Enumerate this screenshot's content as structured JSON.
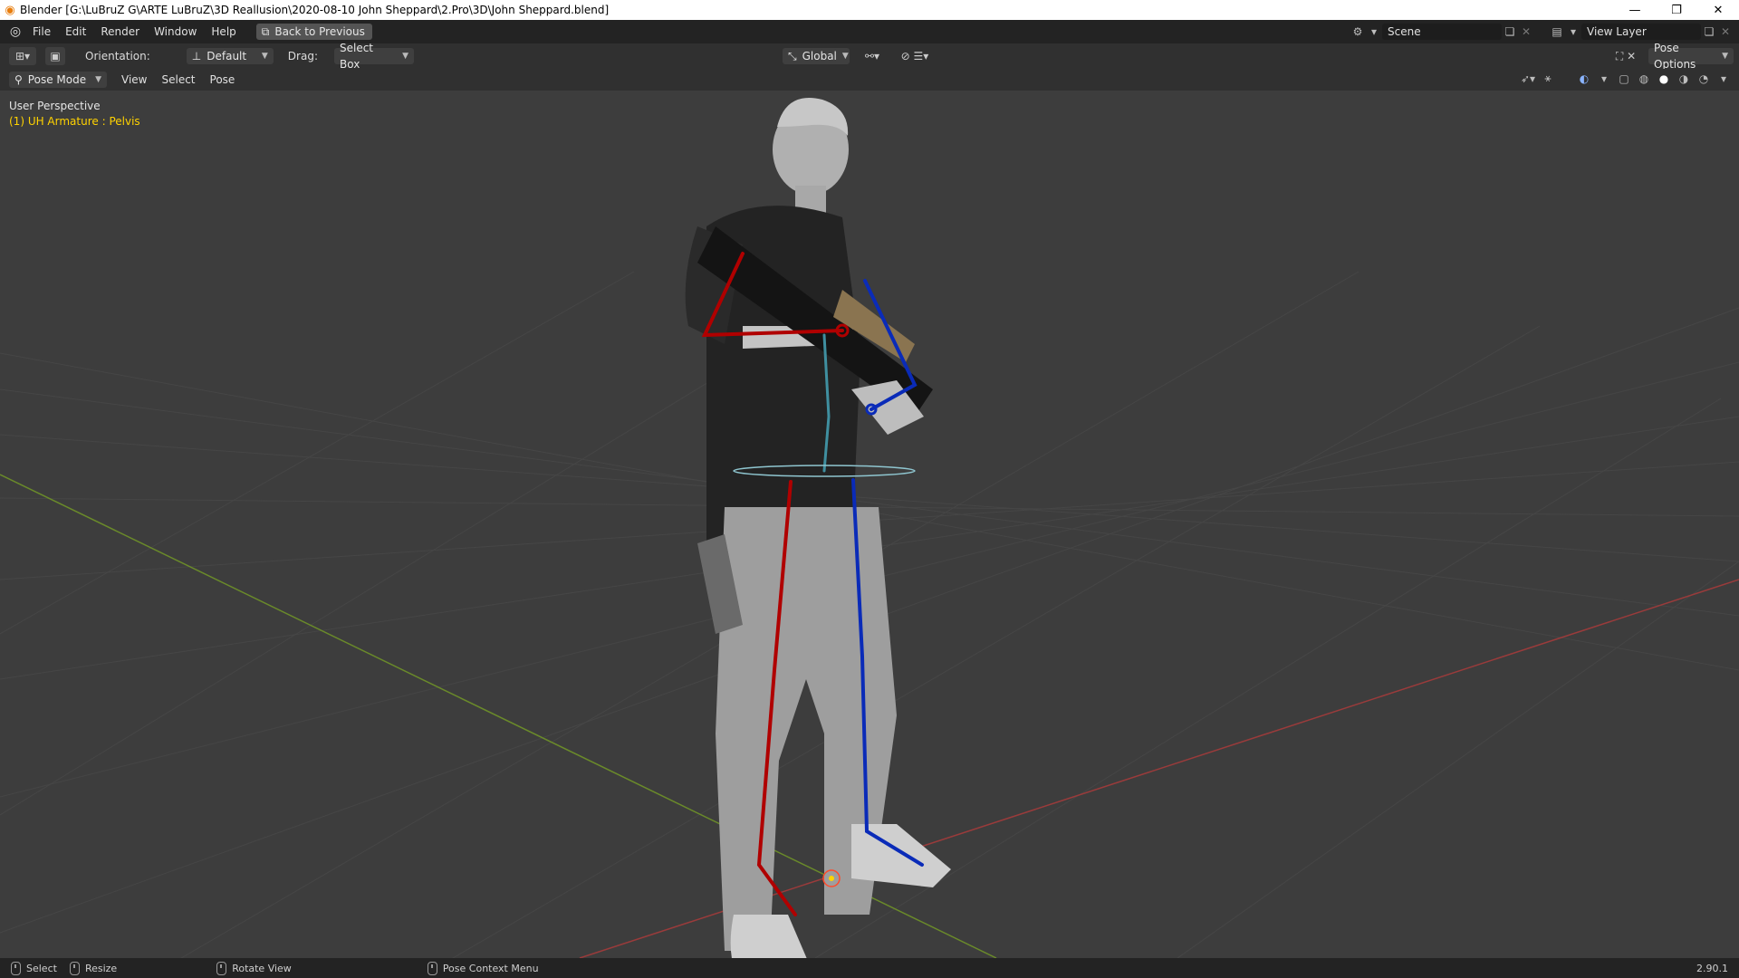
{
  "window": {
    "title": "Blender [G:\\LuBruZ G\\ARTE LuBruZ\\3D Reallusion\\2020-08-10 John Sheppard\\2.Pro\\3D\\John Sheppard.blend]",
    "minimize_glyph": "—",
    "restore_glyph": "❐",
    "close_glyph": "✕"
  },
  "topbar": {
    "menus": [
      "File",
      "Edit",
      "Render",
      "Window",
      "Help"
    ],
    "back_button": "Back to Previous",
    "scene_name": "Scene",
    "view_layer_name": "View Layer"
  },
  "toolheader": {
    "orientation_label": "Orientation:",
    "orientation_value": "Default",
    "drag_label": "Drag:",
    "drag_value": "Select Box",
    "transform_orientation": "Global",
    "pose_options": "Pose Options"
  },
  "modeheader": {
    "mode": "Pose Mode",
    "menus": [
      "View",
      "Select",
      "Pose"
    ]
  },
  "viewport": {
    "perspective_label": "User Perspective",
    "active_object_label": "(1) UH Armature : Pelvis",
    "active_label_color": "#ffd200",
    "left_bone_color": "#b00000",
    "right_bone_color": "#0a2bb8",
    "spine_bone_color": "#3f8fa0"
  },
  "statusbar": {
    "items": [
      "Select",
      "Resize",
      "Rotate View",
      "Pose Context Menu"
    ],
    "version": "2.90.1"
  },
  "icons": [
    "blender-logo-icon",
    "editor-type-icon",
    "select-tool-icon",
    "pivot-icon",
    "snap-icon",
    "proportional-icon",
    "gizmo-icon",
    "overlay-icon",
    "xray-icon",
    "shading-wireframe-icon",
    "shading-solid-icon",
    "shading-material-icon",
    "shading-rendered-icon"
  ]
}
